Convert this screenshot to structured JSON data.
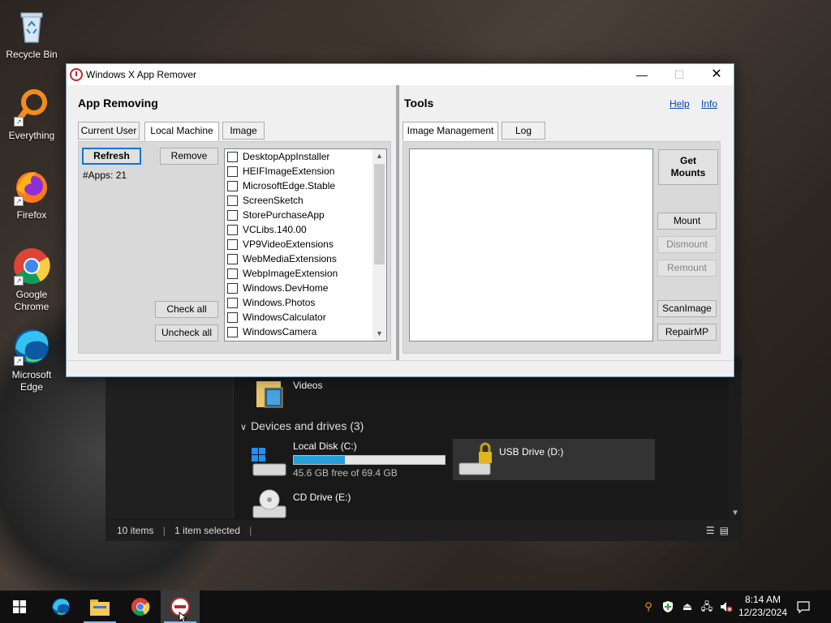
{
  "desktop": {
    "icons": [
      {
        "label": "Recycle Bin",
        "icon": "recycle-bin-icon"
      },
      {
        "label": "Everything",
        "icon": "everything-search-icon"
      },
      {
        "label": "Firefox",
        "icon": "firefox-icon"
      },
      {
        "label": "Google Chrome",
        "icon": "chrome-icon"
      },
      {
        "label": "Microsoft Edge",
        "icon": "edge-icon"
      }
    ]
  },
  "explorer": {
    "folders": [
      {
        "label": "Videos",
        "icon": "videos-folder-icon"
      }
    ],
    "devices_header": "Devices and drives (3)",
    "drives": [
      {
        "label": "Local Disk (C:)",
        "free": "45.6 GB free of 69.4 GB",
        "used_fraction": 0.34,
        "icon": "windows-drive-icon"
      },
      {
        "label": "USB Drive (D:)",
        "icon": "locked-usb-drive-icon"
      },
      {
        "label": "CD Drive (E:)",
        "icon": "cd-drive-icon"
      }
    ],
    "status": {
      "items": "10 items",
      "selected": "1 item selected"
    }
  },
  "app": {
    "title": "Windows X App Remover",
    "controls": {
      "minimize": "—",
      "maximize": "☐",
      "close": "✕"
    },
    "left": {
      "title": "App Removing",
      "tabs": [
        {
          "label": "Current User",
          "active": false
        },
        {
          "label": "Local Machine",
          "active": true
        },
        {
          "label": "Image",
          "active": false
        }
      ],
      "refresh_label": "Refresh",
      "remove_label": "Remove",
      "apps_count": "#Apps: 21",
      "check_all_label": "Check all",
      "uncheck_all_label": "Uncheck all",
      "apps": [
        "DesktopAppInstaller",
        "HEIFImageExtension",
        "MicrosoftEdge.Stable",
        "ScreenSketch",
        "StorePurchaseApp",
        "VCLibs.140.00",
        "VP9VideoExtensions",
        "WebMediaExtensions",
        "WebpImageExtension",
        "Windows.DevHome",
        "Windows.Photos",
        "WindowsCalculator",
        "WindowsCamera"
      ]
    },
    "right": {
      "title": "Tools",
      "help_label": "Help",
      "info_label": "Info",
      "tabs": [
        {
          "label": "Image Management",
          "active": true
        },
        {
          "label": "Log",
          "active": false
        }
      ],
      "get_mounts_label": "Get Mounts",
      "mount_label": "Mount",
      "dismount_label": "Dismount",
      "remount_label": "Remount",
      "scanimage_label": "ScanImage",
      "repairmp_label": "RepairMP"
    }
  },
  "taskbar": {
    "apps": [
      {
        "name": "start",
        "icon": "windows-start-icon"
      },
      {
        "name": "edge",
        "icon": "edge-icon"
      },
      {
        "name": "file-explorer",
        "icon": "file-explorer-icon"
      },
      {
        "name": "chrome",
        "icon": "chrome-icon"
      },
      {
        "name": "app-remover",
        "icon": "app-remover-icon"
      }
    ],
    "clock_time": "8:14 AM",
    "clock_date": "12/23/2024"
  },
  "colors": {
    "accent": "#0078d7",
    "link": "#0645ad",
    "drive_fill": "#26a0da"
  }
}
